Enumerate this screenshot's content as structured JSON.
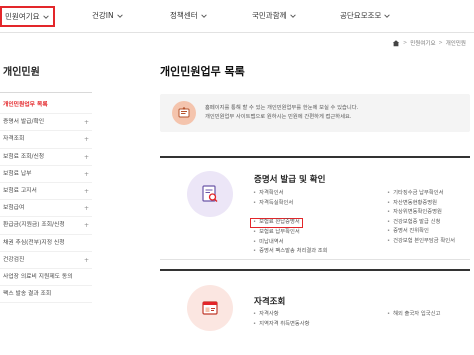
{
  "topnav": {
    "items": [
      {
        "label": "민원여기요",
        "active": true
      },
      {
        "label": "건강IN",
        "active": false
      },
      {
        "label": "정책센터",
        "active": false
      },
      {
        "label": "국민과함께",
        "active": false
      },
      {
        "label": "공단요모조모",
        "active": false
      }
    ]
  },
  "breadcrumb": {
    "items": [
      "민원여기요",
      "개인민원"
    ]
  },
  "sidebar": {
    "title": "개인민원",
    "items": [
      {
        "label": "개인민원업무 목록",
        "active": true
      },
      {
        "label": "증명서 발급/확인",
        "expand": "+"
      },
      {
        "label": "자격조회",
        "expand": "+"
      },
      {
        "label": "보험료 조회/신청",
        "expand": "+"
      },
      {
        "label": "보험료 납부",
        "expand": "+"
      },
      {
        "label": "보험료 고지서",
        "expand": "+"
      },
      {
        "label": "보험급여",
        "expand": "+"
      },
      {
        "label": "환급금(지원금) 조회/신청",
        "expand": "+"
      },
      {
        "label": "채권 추심(전부)지정 신청",
        "expand": ""
      },
      {
        "label": "건강검진",
        "expand": "+"
      },
      {
        "label": "사업장 의료비 지원제도 동의",
        "expand": ""
      },
      {
        "label": "팩스 발송 결과 조회",
        "expand": ""
      }
    ]
  },
  "main": {
    "title": "개인민원업무 목록",
    "notice": [
      "홈페이지를 통해 할 수 있는 개인민원업무를 한눈에 보실 수 있습니다.",
      "개인민원업무 사이트맵으로 원하시는 민원에 간편하게 접근하세요."
    ],
    "sections": [
      {
        "title": "증명서 발급 및 확인",
        "col1": [
          "자격확인서",
          "자격득실확인서",
          "보험료 완납증명서",
          "보험료 납부확인서",
          "미납내역서",
          "증명서 팩스발송 처리결과 조회"
        ],
        "col2": [
          "기타징수금 납부확인서",
          "자산변동현황증명원",
          "자상위변동확인증명원",
          "건강보험증 발급 신청",
          "증명서 진위확인",
          "건강보험 본인부담금 확인서"
        ]
      },
      {
        "title": "자격조회",
        "col1": [
          "자격사항",
          "지역자격 취득변동사항"
        ],
        "col2": [
          "해외 출국자 입국신고"
        ]
      }
    ]
  },
  "colors": {
    "accent": "#e3262a",
    "section1_circle": "#ece6f7",
    "section2_circle": "#fbe6e1",
    "notice_icon": "#f4c4ad"
  },
  "icons": {
    "nav_dropdown": "chevron-down-icon",
    "home": "home-icon",
    "notice": "document-icon",
    "section1": "certificate-search-icon",
    "section2": "id-card-icon"
  }
}
